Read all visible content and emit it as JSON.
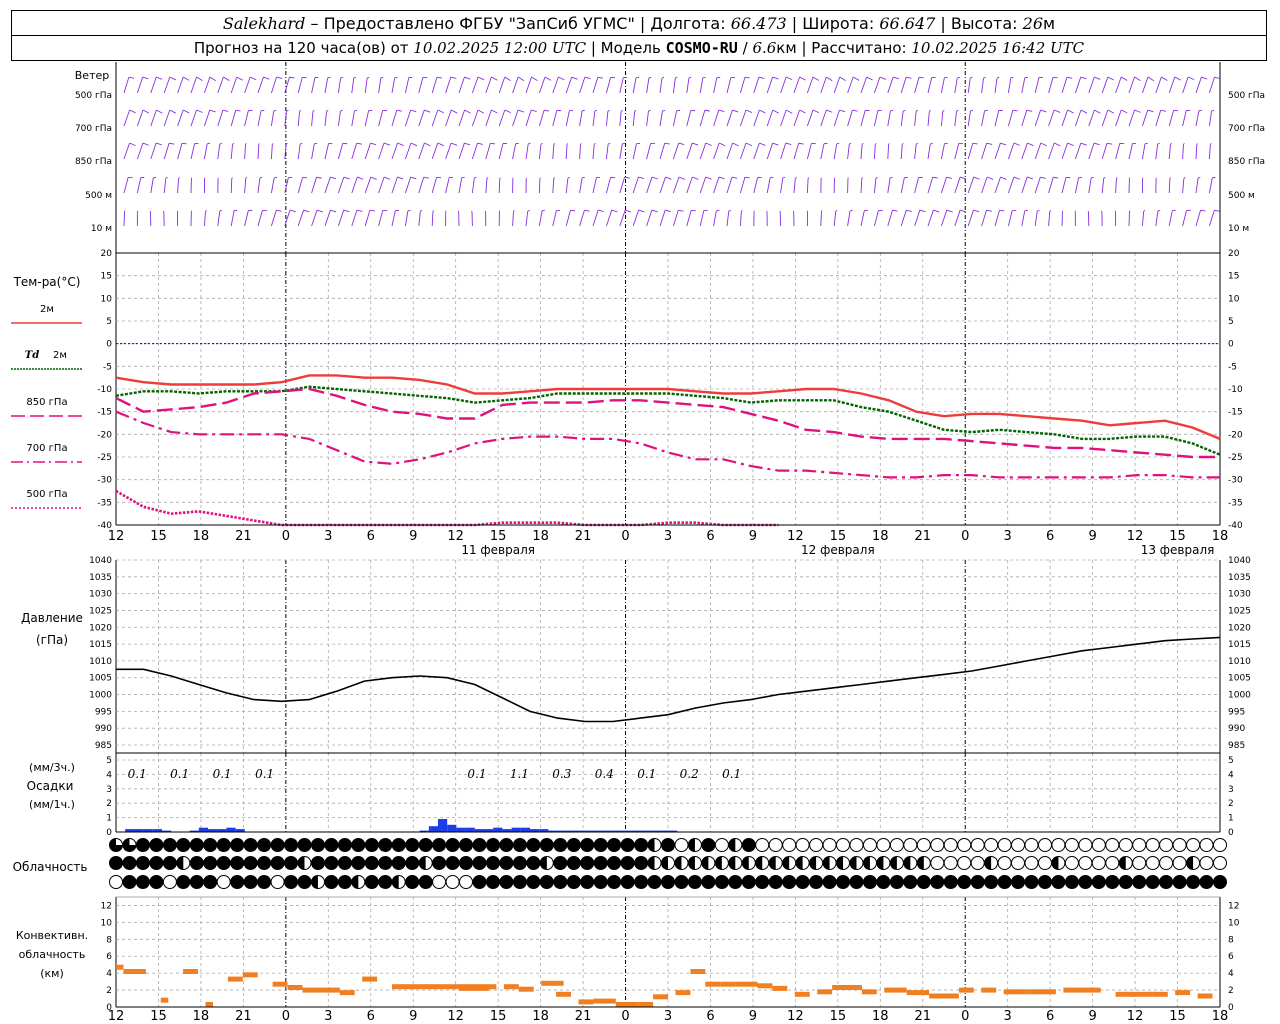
{
  "header": {
    "station": "Salekhard",
    "dash": "–",
    "provider": "Предоставлено ФГБУ \"ЗапСиб УГМС\"",
    "lon_label": "Долгота:",
    "lon_value": "66.473",
    "lat_label": "Широта:",
    "lat_value": "66.647",
    "alt_label": "Высота:",
    "alt_value": "26",
    "alt_unit": "м",
    "forecast_prefix": "Прогноз на 120 часа(ов) от",
    "forecast_start": "10.02.2025 12:00 UTC",
    "model_label": "Модель",
    "model_name": "COSMO-RU",
    "model_res": "6.6",
    "model_unit": "км",
    "computed_label": "Рассчитано:",
    "computed_time": "10.02.2025 16:42 UTC"
  },
  "colors": {
    "wind": "#8a2be2",
    "t2m": "#ee3b3b",
    "td2m": "#006400",
    "t850": "#e0117f",
    "t700": "#e0117f",
    "t500": "#e0117f",
    "zero_line": "#0000ff",
    "pressure": "#000000",
    "precip": "#1c3de8",
    "conv": "#f07f22"
  },
  "time_axis": {
    "hour_labels": [
      "12",
      "15",
      "18",
      "21",
      "0",
      "3",
      "6",
      "9",
      "12",
      "15",
      "18",
      "21",
      "0",
      "3",
      "6",
      "9",
      "12",
      "15",
      "18",
      "21",
      "0",
      "3",
      "6",
      "9",
      "12",
      "15",
      "18"
    ],
    "day_labels": [
      {
        "text": "11 февраля",
        "hour_index": 9
      },
      {
        "text": "12 февраля",
        "hour_index": 17
      },
      {
        "text": "13 февраля",
        "hour_index": 25
      }
    ]
  },
  "wind_panel": {
    "title": "Ветер",
    "levels": [
      "500 гПа",
      "700 гПа",
      "850 гПа",
      "500 м",
      "10 м"
    ]
  },
  "temperature_panel": {
    "title": "Тем-ра(°С)",
    "ticks": [
      20,
      15,
      10,
      5,
      0,
      -5,
      -10,
      -15,
      -20,
      -25,
      -30,
      -35,
      -40
    ],
    "legend": [
      {
        "key": "t2m",
        "label": "2м",
        "style": "solid"
      },
      {
        "key": "td2m",
        "label_prefix": "Td",
        "label": "2м",
        "style": "dotted"
      },
      {
        "key": "t850",
        "label": "850 гПа",
        "style": "dash"
      },
      {
        "key": "t700",
        "label": "700 гПа",
        "style": "dashdot"
      },
      {
        "key": "t500",
        "label": "500 гПа",
        "style": "dot"
      }
    ]
  },
  "pressure_panel": {
    "title_line1": "Давление",
    "title_line2": "(гПа)",
    "ticks": [
      1040,
      1035,
      1030,
      1025,
      1020,
      1015,
      1010,
      1005,
      1000,
      995,
      990,
      985
    ]
  },
  "precip_panel": {
    "title_line1": "(мм/3ч.)",
    "title_line2": "Осадки",
    "title_line3": "(мм/1ч.)",
    "ticks": [
      5,
      4,
      3,
      2,
      1,
      0
    ],
    "totals": [
      {
        "hour_index": 0.5,
        "text": "0.1"
      },
      {
        "hour_index": 1.5,
        "text": "0.1"
      },
      {
        "hour_index": 2.5,
        "text": "0.1"
      },
      {
        "hour_index": 3.5,
        "text": "0.1"
      },
      {
        "hour_index": 8.5,
        "text": "0.1"
      },
      {
        "hour_index": 9.5,
        "text": "1.1"
      },
      {
        "hour_index": 10.5,
        "text": "0.3"
      },
      {
        "hour_index": 11.5,
        "text": "0.4"
      },
      {
        "hour_index": 12.5,
        "text": "0.1"
      },
      {
        "hour_index": 13.5,
        "text": "0.2"
      },
      {
        "hour_index": 14.5,
        "text": "0.1"
      }
    ]
  },
  "cloud_panel": {
    "title": "Облачность"
  },
  "conv_panel": {
    "title_line1": "Конвективн.",
    "title_line2": "облачность",
    "title_line3": "(км)",
    "ticks": [
      12,
      10,
      8,
      6,
      4,
      2,
      0
    ]
  },
  "chart_data": {
    "type": "line",
    "x_unit": "hours from 10.02.2025 12:00 UTC",
    "temperature": {
      "ylim": [
        -40,
        20
      ],
      "series": [
        {
          "name": "2м",
          "x": [
            0,
            3,
            6,
            9,
            12,
            15,
            18,
            21,
            24,
            27,
            30,
            33,
            36,
            39,
            42,
            45,
            48,
            51,
            54,
            57,
            60,
            63,
            66,
            69,
            72,
            75,
            78,
            81,
            84,
            87,
            90,
            93,
            96,
            99,
            102,
            105,
            108,
            111,
            114,
            117,
            120
          ],
          "values": [
            -7.5,
            -8.5,
            -9,
            -9,
            -9,
            -9,
            -8.5,
            -7,
            -7,
            -7.5,
            -7.5,
            -8,
            -9,
            -11,
            -11,
            -10.5,
            -10,
            -10,
            -10,
            -10,
            -10,
            -10.5,
            -11,
            -11,
            -10.5,
            -10,
            -10,
            -11,
            -12.5,
            -15,
            -16,
            -15.5,
            -15.5,
            -16,
            -16.5,
            -17,
            -18,
            -17.5,
            -17,
            -18.5,
            -21
          ]
        },
        {
          "name": "Td 2м",
          "x": [
            0,
            3,
            6,
            9,
            12,
            15,
            18,
            21,
            24,
            27,
            30,
            33,
            36,
            39,
            42,
            45,
            48,
            51,
            54,
            57,
            60,
            63,
            66,
            69,
            72,
            75,
            78,
            81,
            84,
            87,
            90,
            93,
            96,
            99,
            102,
            105,
            108,
            111,
            114,
            117,
            120
          ],
          "values": [
            -11.5,
            -10.5,
            -10.5,
            -11,
            -10.5,
            -10.5,
            -10.5,
            -9.5,
            -10,
            -10.5,
            -11,
            -11.5,
            -12,
            -13,
            -12.5,
            -12,
            -11,
            -11,
            -11,
            -11,
            -11,
            -11.5,
            -12,
            -13,
            -12.5,
            -12.5,
            -12.5,
            -14,
            -15,
            -17,
            -19,
            -19.5,
            -19,
            -19.5,
            -20,
            -21,
            -21,
            -20.5,
            -20.5,
            -22,
            -24.5
          ]
        },
        {
          "name": "850 гПа",
          "x": [
            0,
            3,
            6,
            9,
            12,
            15,
            18,
            21,
            24,
            27,
            30,
            33,
            36,
            39,
            42,
            45,
            48,
            51,
            54,
            57,
            60,
            63,
            66,
            69,
            72,
            75,
            78,
            81,
            84,
            87,
            90,
            93,
            96,
            99,
            102,
            105,
            108,
            111,
            114,
            117,
            120
          ],
          "values": [
            -12,
            -15,
            -14.5,
            -14,
            -13,
            -11,
            -10.5,
            -10,
            -11.5,
            -13.5,
            -15,
            -15.5,
            -16.5,
            -16.5,
            -13.5,
            -13,
            -13,
            -13,
            -12.5,
            -12.5,
            -13,
            -13.5,
            -14,
            -15.5,
            -17,
            -19,
            -19.5,
            -20.5,
            -21,
            -21,
            -21,
            -21.5,
            -22,
            -22.5,
            -23,
            -23,
            -23.5,
            -24,
            -24.5,
            -25,
            -25
          ]
        },
        {
          "name": "700 гПа",
          "x": [
            0,
            3,
            6,
            9,
            12,
            15,
            18,
            21,
            24,
            27,
            30,
            33,
            36,
            39,
            42,
            45,
            48,
            51,
            54,
            57,
            60,
            63,
            66,
            69,
            72,
            75,
            78,
            81,
            84,
            87,
            90,
            93,
            96,
            99,
            102,
            105,
            108,
            111,
            114,
            117,
            120
          ],
          "values": [
            -15,
            -17.5,
            -19.5,
            -20,
            -20,
            -20,
            -20,
            -21,
            -23.5,
            -26,
            -26.5,
            -25.5,
            -24,
            -22,
            -21,
            -20.5,
            -20.5,
            -21,
            -21,
            -22,
            -24,
            -25.5,
            -25.5,
            -27,
            -28,
            -28,
            -28.5,
            -29,
            -29.5,
            -29.5,
            -29,
            -29,
            -29.5,
            -29.5,
            -29.5,
            -29.5,
            -29.5,
            -29,
            -29,
            -29.5,
            -29.5
          ]
        },
        {
          "name": "500 гПа",
          "x": [
            0,
            3,
            6,
            9,
            12,
            15,
            18,
            21,
            24,
            27,
            30,
            33,
            36,
            39,
            42,
            45,
            48,
            51,
            54,
            57,
            60,
            63,
            66,
            69,
            72
          ],
          "values": [
            -32.5,
            -36,
            -37.5,
            -37,
            -38,
            -39,
            -40,
            -41,
            -41,
            -40.5,
            -40,
            -40,
            -40,
            -40,
            -39.5,
            -39.5,
            -39.5,
            -40,
            -40,
            -40,
            -39.5,
            -39.5,
            -40,
            -40.5,
            -41
          ]
        }
      ]
    },
    "pressure": {
      "ylim": [
        985,
        1040
      ],
      "x": [
        0,
        3,
        6,
        9,
        12,
        15,
        18,
        21,
        24,
        27,
        30,
        33,
        36,
        39,
        42,
        45,
        48,
        51,
        54,
        57,
        60,
        63,
        66,
        69,
        72,
        75,
        78,
        81,
        84,
        87,
        90,
        93,
        96,
        99,
        102,
        105,
        108,
        111,
        114,
        117,
        120
      ],
      "values": [
        1007.5,
        1007.5,
        1005.5,
        1003,
        1000.5,
        998.5,
        998,
        998.5,
        1001,
        1004,
        1005,
        1005.5,
        1005,
        1003,
        999,
        995,
        993,
        992,
        992,
        993,
        994,
        996,
        997.5,
        998.5,
        1000,
        1001,
        1002,
        1003,
        1004,
        1005,
        1006,
        1007,
        1008.5,
        1010,
        1011.5,
        1013,
        1014,
        1015,
        1016,
        1016.5,
        1017
      ]
    },
    "precipitation_1h": {
      "ylim": [
        0,
        5
      ],
      "x": [
        1,
        2,
        3,
        4,
        5,
        8,
        9,
        10,
        11,
        12,
        13,
        33,
        34,
        35,
        36,
        37,
        38,
        39,
        40,
        41,
        42,
        43,
        44,
        45,
        46,
        47,
        48,
        49,
        50,
        51,
        52,
        53,
        54,
        55,
        56,
        57,
        58,
        59,
        60
      ],
      "values": [
        0.2,
        0.2,
        0.2,
        0.2,
        0.1,
        0.1,
        0.3,
        0.2,
        0.2,
        0.3,
        0.2,
        0.1,
        0.4,
        0.9,
        0.5,
        0.3,
        0.3,
        0.2,
        0.2,
        0.3,
        0.2,
        0.3,
        0.3,
        0.2,
        0.2,
        0.1,
        0.1,
        0.1,
        0.1,
        0.1,
        0.1,
        0.1,
        0.1,
        0.1,
        0.1,
        0.1,
        0.1,
        0.1,
        0.1
      ]
    },
    "convective_cloud_top_km": {
      "ylim": [
        0,
        13
      ],
      "segments": [
        {
          "x0": 0,
          "x1": 1,
          "y": 4.7
        },
        {
          "x0": 1,
          "x1": 3,
          "y": 4.2
        },
        {
          "x0": 3,
          "x1": 4,
          "y": 4.2
        },
        {
          "x0": 6,
          "x1": 7,
          "y": 0.8
        },
        {
          "x0": 9,
          "x1": 11,
          "y": 4.2
        },
        {
          "x0": 12,
          "x1": 13,
          "y": 0.3
        },
        {
          "x0": 15,
          "x1": 17,
          "y": 3.3
        },
        {
          "x0": 17,
          "x1": 19,
          "y": 3.8
        },
        {
          "x0": 21,
          "x1": 23,
          "y": 2.7
        },
        {
          "x0": 23,
          "x1": 25,
          "y": 2.3
        },
        {
          "x0": 25,
          "x1": 30,
          "y": 2.0
        },
        {
          "x0": 30,
          "x1": 32,
          "y": 1.7
        },
        {
          "x0": 33,
          "x1": 35,
          "y": 3.3
        },
        {
          "x0": 37,
          "x1": 51,
          "y": 2.4
        },
        {
          "x0": 46,
          "x1": 50,
          "y": 2.2
        },
        {
          "x0": 52,
          "x1": 54,
          "y": 2.4
        },
        {
          "x0": 54,
          "x1": 56,
          "y": 2.1
        },
        {
          "x0": 57,
          "x1": 60,
          "y": 2.8
        },
        {
          "x0": 59,
          "x1": 61,
          "y": 1.5
        },
        {
          "x0": 62,
          "x1": 64,
          "y": 0.6
        },
        {
          "x0": 64,
          "x1": 67,
          "y": 0.7
        },
        {
          "x0": 67,
          "x1": 70,
          "y": 0.3
        },
        {
          "x0": 70,
          "x1": 72,
          "y": 0.3
        },
        {
          "x0": 72,
          "x1": 74,
          "y": 1.2
        },
        {
          "x0": 75,
          "x1": 77,
          "y": 1.7
        },
        {
          "x0": 77,
          "x1": 79,
          "y": 4.2
        },
        {
          "x0": 79,
          "x1": 81,
          "y": 2.7
        },
        {
          "x0": 81,
          "x1": 83,
          "y": 2.7
        },
        {
          "x0": 83,
          "x1": 86,
          "y": 2.7
        },
        {
          "x0": 86,
          "x1": 88,
          "y": 2.5
        },
        {
          "x0": 88,
          "x1": 90,
          "y": 2.2
        },
        {
          "x0": 91,
          "x1": 93,
          "y": 1.5
        },
        {
          "x0": 94,
          "x1": 96,
          "y": 1.8
        },
        {
          "x0": 96,
          "x1": 100,
          "y": 2.3
        },
        {
          "x0": 100,
          "x1": 102,
          "y": 1.8
        },
        {
          "x0": 103,
          "x1": 106,
          "y": 2.0
        },
        {
          "x0": 106,
          "x1": 109,
          "y": 1.7
        },
        {
          "x0": 109,
          "x1": 111,
          "y": 1.3
        },
        {
          "x0": 111,
          "x1": 113,
          "y": 1.3
        },
        {
          "x0": 113,
          "x1": 115,
          "y": 2.0
        },
        {
          "x0": 116,
          "x1": 118,
          "y": 2.0
        },
        {
          "x0": 119,
          "x1": 122,
          "y": 1.8
        },
        {
          "x0": 122,
          "x1": 126,
          "y": 1.8
        },
        {
          "x0": 127,
          "x1": 132,
          "y": 2.0
        },
        {
          "x0": 134,
          "x1": 139,
          "y": 1.5
        },
        {
          "x0": 139,
          "x1": 141,
          "y": 1.5
        },
        {
          "x0": 142,
          "x1": 144,
          "y": 1.7
        },
        {
          "x0": 145,
          "x1": 147,
          "y": 1.3
        }
      ]
    },
    "cloudiness": {
      "rows": [
        "верхний ярус",
        "средний ярус",
        "нижний ярус"
      ],
      "x_step_hours": 3,
      "upper": [
        4,
        2,
        0,
        0,
        0,
        0,
        0,
        0,
        0,
        0,
        0,
        0,
        0,
        0,
        0,
        0,
        0,
        0,
        0,
        0,
        0,
        0,
        0,
        0,
        0,
        0,
        0,
        0,
        0,
        0,
        0,
        0,
        0,
        0,
        0,
        0,
        0,
        0,
        0,
        0,
        0,
        0,
        0,
        0,
        0,
        0,
        0,
        0,
        0,
        0,
        0,
        0,
        0,
        0,
        0,
        0,
        0,
        0,
        0,
        0,
        0,
        0,
        0,
        0,
        0,
        0,
        0,
        0,
        0,
        0,
        0,
        0,
        0,
        0,
        0,
        0,
        0,
        0,
        0,
        0,
        0,
        0,
        0,
        0,
        0,
        0,
        0,
        0,
        0,
        0,
        0,
        0,
        0,
        0,
        0,
        0,
        0,
        0,
        0,
        0,
        0,
        0,
        0,
        0,
        0,
        0,
        0,
        0,
        0,
        0,
        0,
        0,
        0,
        0,
        0,
        0,
        0,
        0,
        0,
        0,
        0
      ],
      "middle": [],
      "lower": []
    }
  }
}
